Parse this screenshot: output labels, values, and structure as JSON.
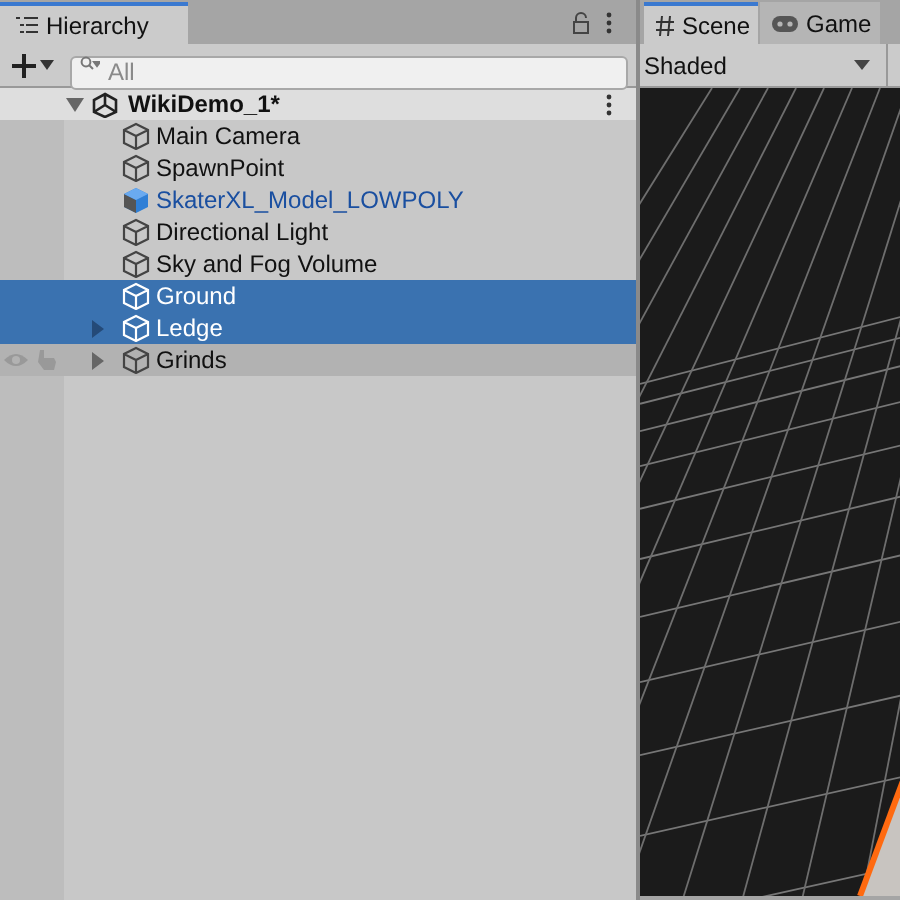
{
  "hierarchy": {
    "tab": {
      "title": "Hierarchy",
      "selected": true
    },
    "search": {
      "placeholder": "All"
    },
    "scene": {
      "name": "WikiDemo_1*",
      "expanded": true
    },
    "items": [
      {
        "name": "Main Camera",
        "kind": "object",
        "expandable": false,
        "selected": false,
        "hovered": false
      },
      {
        "name": "SpawnPoint",
        "kind": "object",
        "expandable": false,
        "selected": false,
        "hovered": false
      },
      {
        "name": "SkaterXL_Model_LOWPOLY",
        "kind": "prefab",
        "expandable": false,
        "selected": false,
        "hovered": false
      },
      {
        "name": "Directional Light",
        "kind": "object",
        "expandable": false,
        "selected": false,
        "hovered": false
      },
      {
        "name": "Sky and Fog Volume",
        "kind": "object",
        "expandable": false,
        "selected": false,
        "hovered": false
      },
      {
        "name": "Ground",
        "kind": "object",
        "expandable": false,
        "selected": true,
        "hovered": false
      },
      {
        "name": "Ledge",
        "kind": "object",
        "expandable": true,
        "selected": true,
        "hovered": false
      },
      {
        "name": "Grinds",
        "kind": "object",
        "expandable": true,
        "selected": false,
        "hovered": true
      }
    ]
  },
  "scene_view": {
    "tabs": [
      {
        "label": "Scene",
        "kind": "scene",
        "selected": true
      },
      {
        "label": "Game",
        "kind": "game",
        "selected": false
      }
    ],
    "shading": "Shaded"
  }
}
